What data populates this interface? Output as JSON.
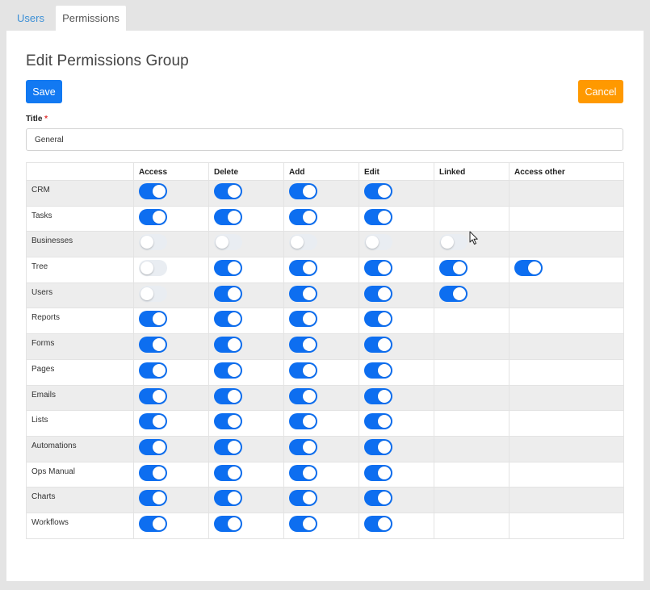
{
  "tabs": [
    {
      "label": "Users",
      "active": false
    },
    {
      "label": "Permissions",
      "active": true
    }
  ],
  "page_title": "Edit Permissions Group",
  "buttons": {
    "save": "Save",
    "cancel": "Cancel"
  },
  "colors": {
    "save": "#1279f2",
    "cancel": "#ff9900",
    "toggle_on": "#0d6ef0",
    "toggle_off": "#e9edf2"
  },
  "title_field": {
    "label": "Title",
    "required_mark": "*",
    "value": "General"
  },
  "columns": [
    "",
    "Access",
    "Delete",
    "Add",
    "Edit",
    "Linked",
    "Access other"
  ],
  "rows": [
    {
      "label": "CRM",
      "toggles": [
        true,
        true,
        true,
        true,
        null,
        null
      ]
    },
    {
      "label": "Tasks",
      "toggles": [
        true,
        true,
        true,
        true,
        null,
        null
      ]
    },
    {
      "label": "Businesses",
      "toggles": [
        false,
        false,
        false,
        false,
        false,
        null
      ]
    },
    {
      "label": "Tree",
      "toggles": [
        false,
        true,
        true,
        true,
        true,
        true
      ]
    },
    {
      "label": "Users",
      "toggles": [
        false,
        true,
        true,
        true,
        true,
        null
      ]
    },
    {
      "label": "Reports",
      "toggles": [
        true,
        true,
        true,
        true,
        null,
        null
      ]
    },
    {
      "label": "Forms",
      "toggles": [
        true,
        true,
        true,
        true,
        null,
        null
      ]
    },
    {
      "label": "Pages",
      "toggles": [
        true,
        true,
        true,
        true,
        null,
        null
      ]
    },
    {
      "label": "Emails",
      "toggles": [
        true,
        true,
        true,
        true,
        null,
        null
      ]
    },
    {
      "label": "Lists",
      "toggles": [
        true,
        true,
        true,
        true,
        null,
        null
      ]
    },
    {
      "label": "Automations",
      "toggles": [
        true,
        true,
        true,
        true,
        null,
        null
      ]
    },
    {
      "label": "Ops Manual",
      "toggles": [
        true,
        true,
        true,
        true,
        null,
        null
      ]
    },
    {
      "label": "Charts",
      "toggles": [
        true,
        true,
        true,
        true,
        null,
        null
      ]
    },
    {
      "label": "Workflows",
      "toggles": [
        true,
        true,
        true,
        true,
        null,
        null
      ]
    }
  ]
}
